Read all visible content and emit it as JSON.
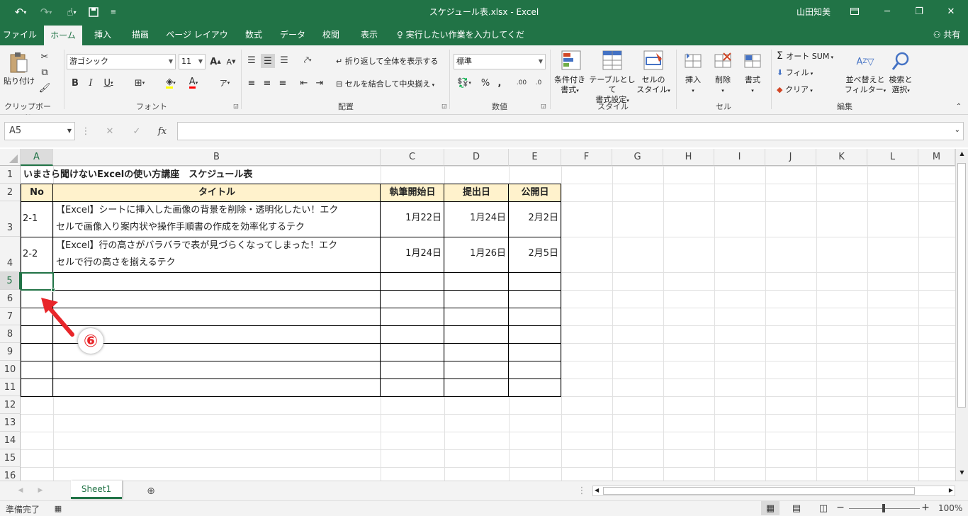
{
  "window": {
    "title": "スケジュール表.xlsx  -  Excel",
    "user": "山田知美",
    "qat": [
      "undo-icon",
      "redo-icon",
      "touch-mode-icon",
      "save-icon",
      "customize-icon"
    ]
  },
  "tabs": [
    "ファイル",
    "ホーム",
    "挿入",
    "描画",
    "ページ レイアウト",
    "数式",
    "データ",
    "校閲",
    "表示"
  ],
  "active_tab": "ホーム",
  "tell_me": "実行したい作業を入力してください",
  "share": "共有",
  "ribbon": {
    "clipboard": {
      "paste": "貼り付け",
      "label": "クリップボード"
    },
    "font": {
      "name": "游ゴシック",
      "size": "11",
      "label": "フォント"
    },
    "alignment": {
      "wrap": "折り返して全体を表示する",
      "merge": "セルを結合して中央揃え",
      "label": "配置"
    },
    "number": {
      "format": "標準",
      "label": "数値"
    },
    "styles": {
      "conditional_1": "条件付き",
      "conditional_2": "書式",
      "table_1": "テーブルとして",
      "table_2": "書式設定",
      "cell_1": "セルの",
      "cell_2": "スタイル",
      "label": "スタイル"
    },
    "cells": {
      "insert": "挿入",
      "delete": "削除",
      "format": "書式",
      "label": "セル"
    },
    "editing": {
      "autosum": "オート SUM",
      "fill": "フィル",
      "clear": "クリア",
      "sort_1": "並べ替えと",
      "sort_2": "フィルター",
      "find_1": "検索と",
      "find_2": "選択",
      "label": "編集"
    }
  },
  "formula_bar": {
    "name_box": "A5",
    "content": ""
  },
  "columns": [
    "A",
    "B",
    "C",
    "D",
    "E",
    "F",
    "G",
    "H",
    "I",
    "J",
    "K",
    "L",
    "M"
  ],
  "rows": [
    "1",
    "2",
    "3",
    "4",
    "5",
    "6",
    "7",
    "8",
    "9",
    "10",
    "11",
    "12",
    "13",
    "14",
    "15",
    "16"
  ],
  "sheet": {
    "title": "いまさら聞けないExcelの使い方講座　スケジュール表",
    "headers": [
      "No",
      "タイトル",
      "執筆開始日",
      "提出日",
      "公開日"
    ],
    "data": [
      {
        "no": "2-1",
        "title_l1": "【Excel】シートに挿入した画像の背景を削除・透明化したい！エク",
        "title_l2": "セルで画像入り案内状や操作手順書の作成を効率化するテク",
        "start": "1月22日",
        "submit": "1月24日",
        "publish": "2月2日"
      },
      {
        "no": "2-2",
        "title_l1": "【Excel】行の高さがバラバラで表が見づらくなってしまった！エク",
        "title_l2": "セルで行の高さを揃えるテク",
        "start": "1月24日",
        "submit": "1月26日",
        "publish": "2月5日"
      }
    ]
  },
  "annotation": "⑥",
  "sheet_tab": "Sheet1",
  "status": {
    "ready": "準備完了",
    "zoom": "100%"
  },
  "colors": {
    "excel_green": "#217346",
    "header_fill": "#fff2cc",
    "arrow_red": "#e8262a"
  }
}
